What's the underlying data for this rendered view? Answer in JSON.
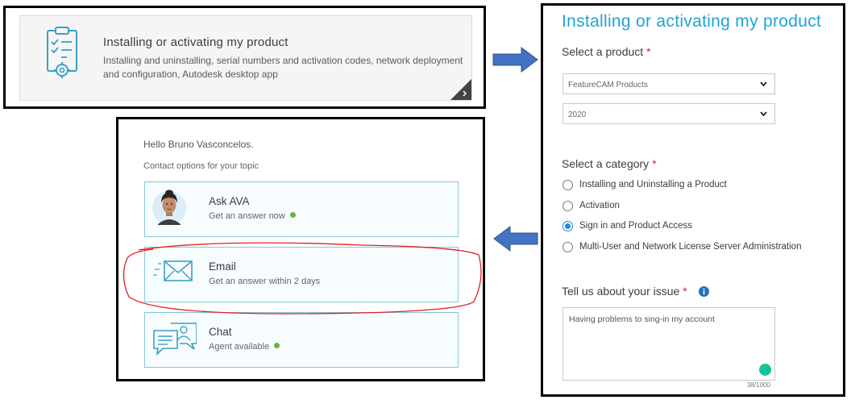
{
  "topic_card": {
    "title": "Installing or activating my product",
    "description": "Installing and uninstalling, serial numbers and activation codes, network deployment and configuration, Autodesk desktop app",
    "icon": "clipboard-gear-icon"
  },
  "contact": {
    "greeting": "Hello Bruno Vasconcelos.",
    "subtitle": "Contact options for your topic",
    "options": [
      {
        "title": "Ask AVA",
        "subtitle": "Get an answer now",
        "icon": "ava-avatar",
        "available": true
      },
      {
        "title": "Email",
        "subtitle": "Get an answer within 2 days",
        "icon": "envelope-icon",
        "available": false
      },
      {
        "title": "Chat",
        "subtitle": "Agent available",
        "icon": "chat-agent-icon",
        "available": true
      }
    ]
  },
  "form": {
    "title": "Installing or activating my product",
    "product_label": "Select a product",
    "required_mark": "*",
    "product_value": "FeatureCAM Products",
    "version_value": "2020",
    "category_label": "Select a category",
    "categories": [
      {
        "label": "Installing and Uninstalling a Product",
        "checked": false
      },
      {
        "label": "Activation",
        "checked": false
      },
      {
        "label": "Sign in and Product Access",
        "checked": true
      },
      {
        "label": "Multi-User and Network License Server Administration",
        "checked": false
      }
    ],
    "issue_label": "Tell us about your issue",
    "issue_text": "Having problems to sing-in my account",
    "char_count": "38/1000"
  },
  "colors": {
    "accent_blue": "#1fa3d8",
    "arrow_blue": "#4472c4",
    "required_red": "#d02a2a",
    "available_green": "#6ab344",
    "highlight_red": "#e02020"
  }
}
